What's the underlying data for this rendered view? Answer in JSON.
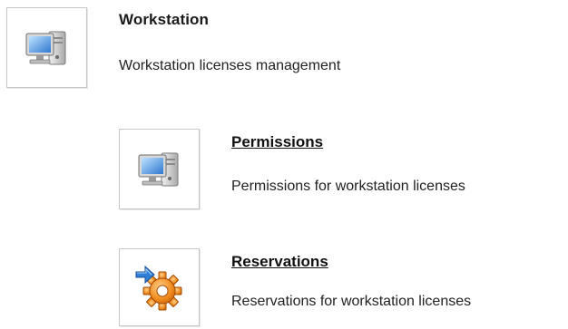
{
  "workstation": {
    "title": "Workstation",
    "description": "Workstation licenses management",
    "icon": "workstation-computer-icon"
  },
  "items": [
    {
      "title": "Permissions",
      "description": "Permissions for workstation licenses",
      "icon": "workstation-computer-icon"
    },
    {
      "title": "Reservations",
      "description": "Reservations for workstation licenses",
      "icon": "gear-arrow-icon"
    }
  ],
  "colors": {
    "border": "#c8c8c8",
    "gear": "#f08a1c",
    "arrow": "#2f7fd6",
    "screen": "#3d8fe0"
  }
}
